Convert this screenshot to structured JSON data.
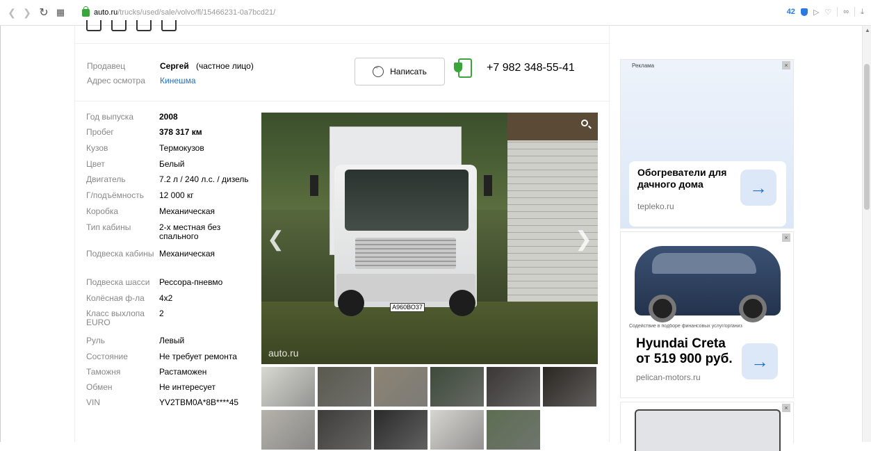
{
  "browser": {
    "url_host": "auto.ru",
    "url_path": "/trucks/used/sale/volvo/fl/15466231-0a7bcd21/",
    "shield_count": "42"
  },
  "seller": {
    "seller_label": "Продавец",
    "seller_name": "Сергей",
    "seller_type": "(частное лицо)",
    "address_label": "Адрес осмотра",
    "address_value": "Кинешма",
    "write_button": "Написать",
    "phone": "+7 982 348-55-41"
  },
  "specs": [
    {
      "label": "Год выпуска",
      "value": "2008",
      "bold": true
    },
    {
      "label": "Пробег",
      "value": "378 317 км",
      "bold": true
    },
    {
      "label": "Кузов",
      "value": "Термокузов"
    },
    {
      "label": "Цвет",
      "value": "Белый"
    },
    {
      "label": "Двигатель",
      "value": "7.2 л / 240 л.с. / дизель"
    },
    {
      "label": "Г/подъёмность",
      "value": "12 000 кг"
    },
    {
      "label": "Коробка",
      "value": "Механическая"
    },
    {
      "label": "Тип кабины",
      "value": "2-х местная без спального"
    },
    {
      "label": "Подвеска кабины",
      "value": "Механическая"
    },
    {
      "label": "Подвеска шасси",
      "value": "Рессора-пневмо"
    },
    {
      "label": "Колёсная ф-ла",
      "value": "4x2"
    },
    {
      "label": "Класс выхлопа EURO",
      "value": "2"
    },
    {
      "label": "Руль",
      "value": "Левый"
    },
    {
      "label": "Состояние",
      "value": "Не требует ремонта"
    },
    {
      "label": "Таможня",
      "value": "Растаможен"
    },
    {
      "label": "Обмен",
      "value": "Не интересует"
    },
    {
      "label": "VIN",
      "value": "YV2TBM0A*8B****45"
    }
  ],
  "photo": {
    "plate": "А960ВО37",
    "watermark": "auto.ru"
  },
  "thumb_colors": [
    "#d9d9d2",
    "#5b5a4f",
    "#8c8474",
    "#3e4a3a",
    "#3a3735",
    "#2a2520",
    "#b6b3ac",
    "#3e3c39",
    "#2b2a2a",
    "#d7d5d0",
    "#5c6e52"
  ],
  "ads": {
    "ad1": {
      "label": "Реклама",
      "close": "×",
      "title": "Обогреватели для дачного дома",
      "domain": "tepleko.ru",
      "arrow": "→"
    },
    "ad2": {
      "close": "×",
      "fine_print": "Содействие в подборе финансовых услуг/организ",
      "title": "Hyundai Creta от 519 900 руб.",
      "domain": "pelican-motors.ru",
      "arrow": "→"
    },
    "ad3": {
      "close": "×"
    }
  }
}
